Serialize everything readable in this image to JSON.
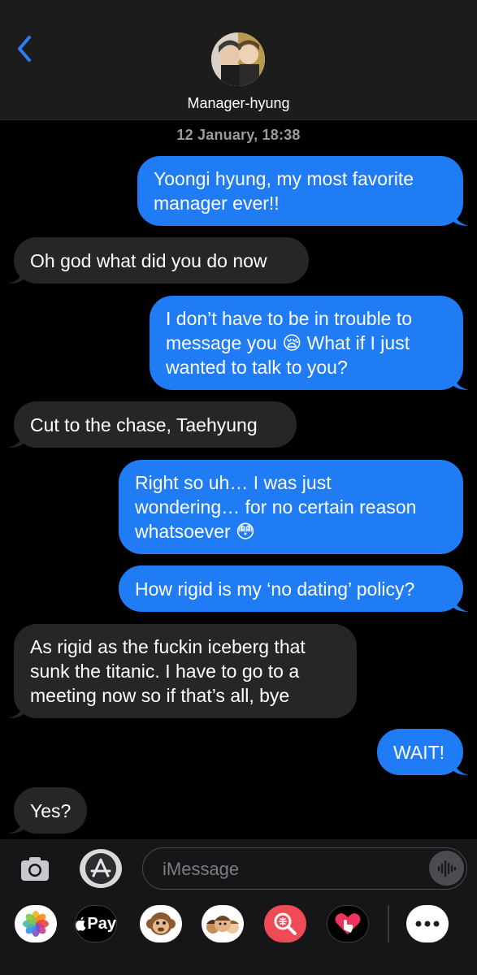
{
  "header": {
    "contact_name": "Manager-hyung",
    "back_icon": "chevron-left-icon",
    "accent_color": "#2f7cf6"
  },
  "timestamp": "12 January, 18:38",
  "messages": [
    {
      "direction": "outgoing",
      "lines": [
        "Yoongi hyung, my most favorite",
        "manager ever!!"
      ]
    },
    {
      "direction": "incoming",
      "lines": [
        "Oh god what did you do now"
      ]
    },
    {
      "direction": "outgoing",
      "lines": [
        "I don’t have to be in trouble to",
        "message you 😪  What if I just",
        "wanted to talk to you?"
      ]
    },
    {
      "direction": "incoming",
      "lines": [
        "Cut to the chase, Taehyung"
      ]
    },
    {
      "direction": "outgoing",
      "lines": [
        "Right so uh… I was just",
        "wondering… for no certain reason",
        "whatsoever 😳"
      ]
    },
    {
      "direction": "outgoing",
      "lines": [
        "How rigid is my ‘no dating’ policy?"
      ]
    },
    {
      "direction": "incoming",
      "lines": [
        "As rigid as the fuckin iceberg that",
        "sunk the titanic. I have to go to a",
        "meeting now so if that’s all, bye"
      ]
    },
    {
      "direction": "outgoing",
      "lines": [
        "WAIT!"
      ]
    },
    {
      "direction": "incoming",
      "lines": [
        "Yes?"
      ]
    }
  ],
  "composer": {
    "placeholder": "iMessage",
    "camera_icon": "camera-icon",
    "appstore_icon": "app-store-icon",
    "audio_icon": "audio-waveform-icon"
  },
  "app_drawer": {
    "items": [
      {
        "name": "photos-app-icon"
      },
      {
        "name": "apple-pay-app-icon",
        "label": "Pay"
      },
      {
        "name": "animoji-app-icon"
      },
      {
        "name": "memoji-app-icon"
      },
      {
        "name": "image-search-app-icon"
      },
      {
        "name": "digital-touch-app-icon"
      },
      {
        "name": "more-apps-icon"
      }
    ]
  },
  "colors": {
    "outgoing_bubble": "#1f7cf5",
    "incoming_bubble": "#262628",
    "background": "#000000"
  }
}
